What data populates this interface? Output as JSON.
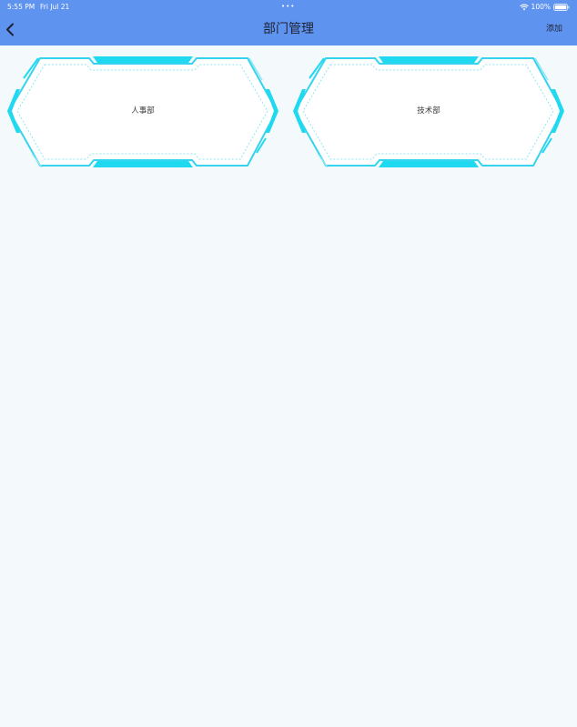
{
  "status_bar": {
    "time": "5:55 PM",
    "date": "Fri Jul 21",
    "dots": "•••",
    "battery": "100%"
  },
  "nav": {
    "title": "部门管理",
    "add_label": "添加",
    "back_icon": "chevron-left-icon"
  },
  "departments": [
    {
      "name": "人事部"
    },
    {
      "name": "技术部"
    }
  ],
  "colors": {
    "header": "#5f93f0",
    "background": "#f4fafb",
    "frame_accent": "#1ed9f0",
    "frame_outline": "#39d2ee"
  }
}
